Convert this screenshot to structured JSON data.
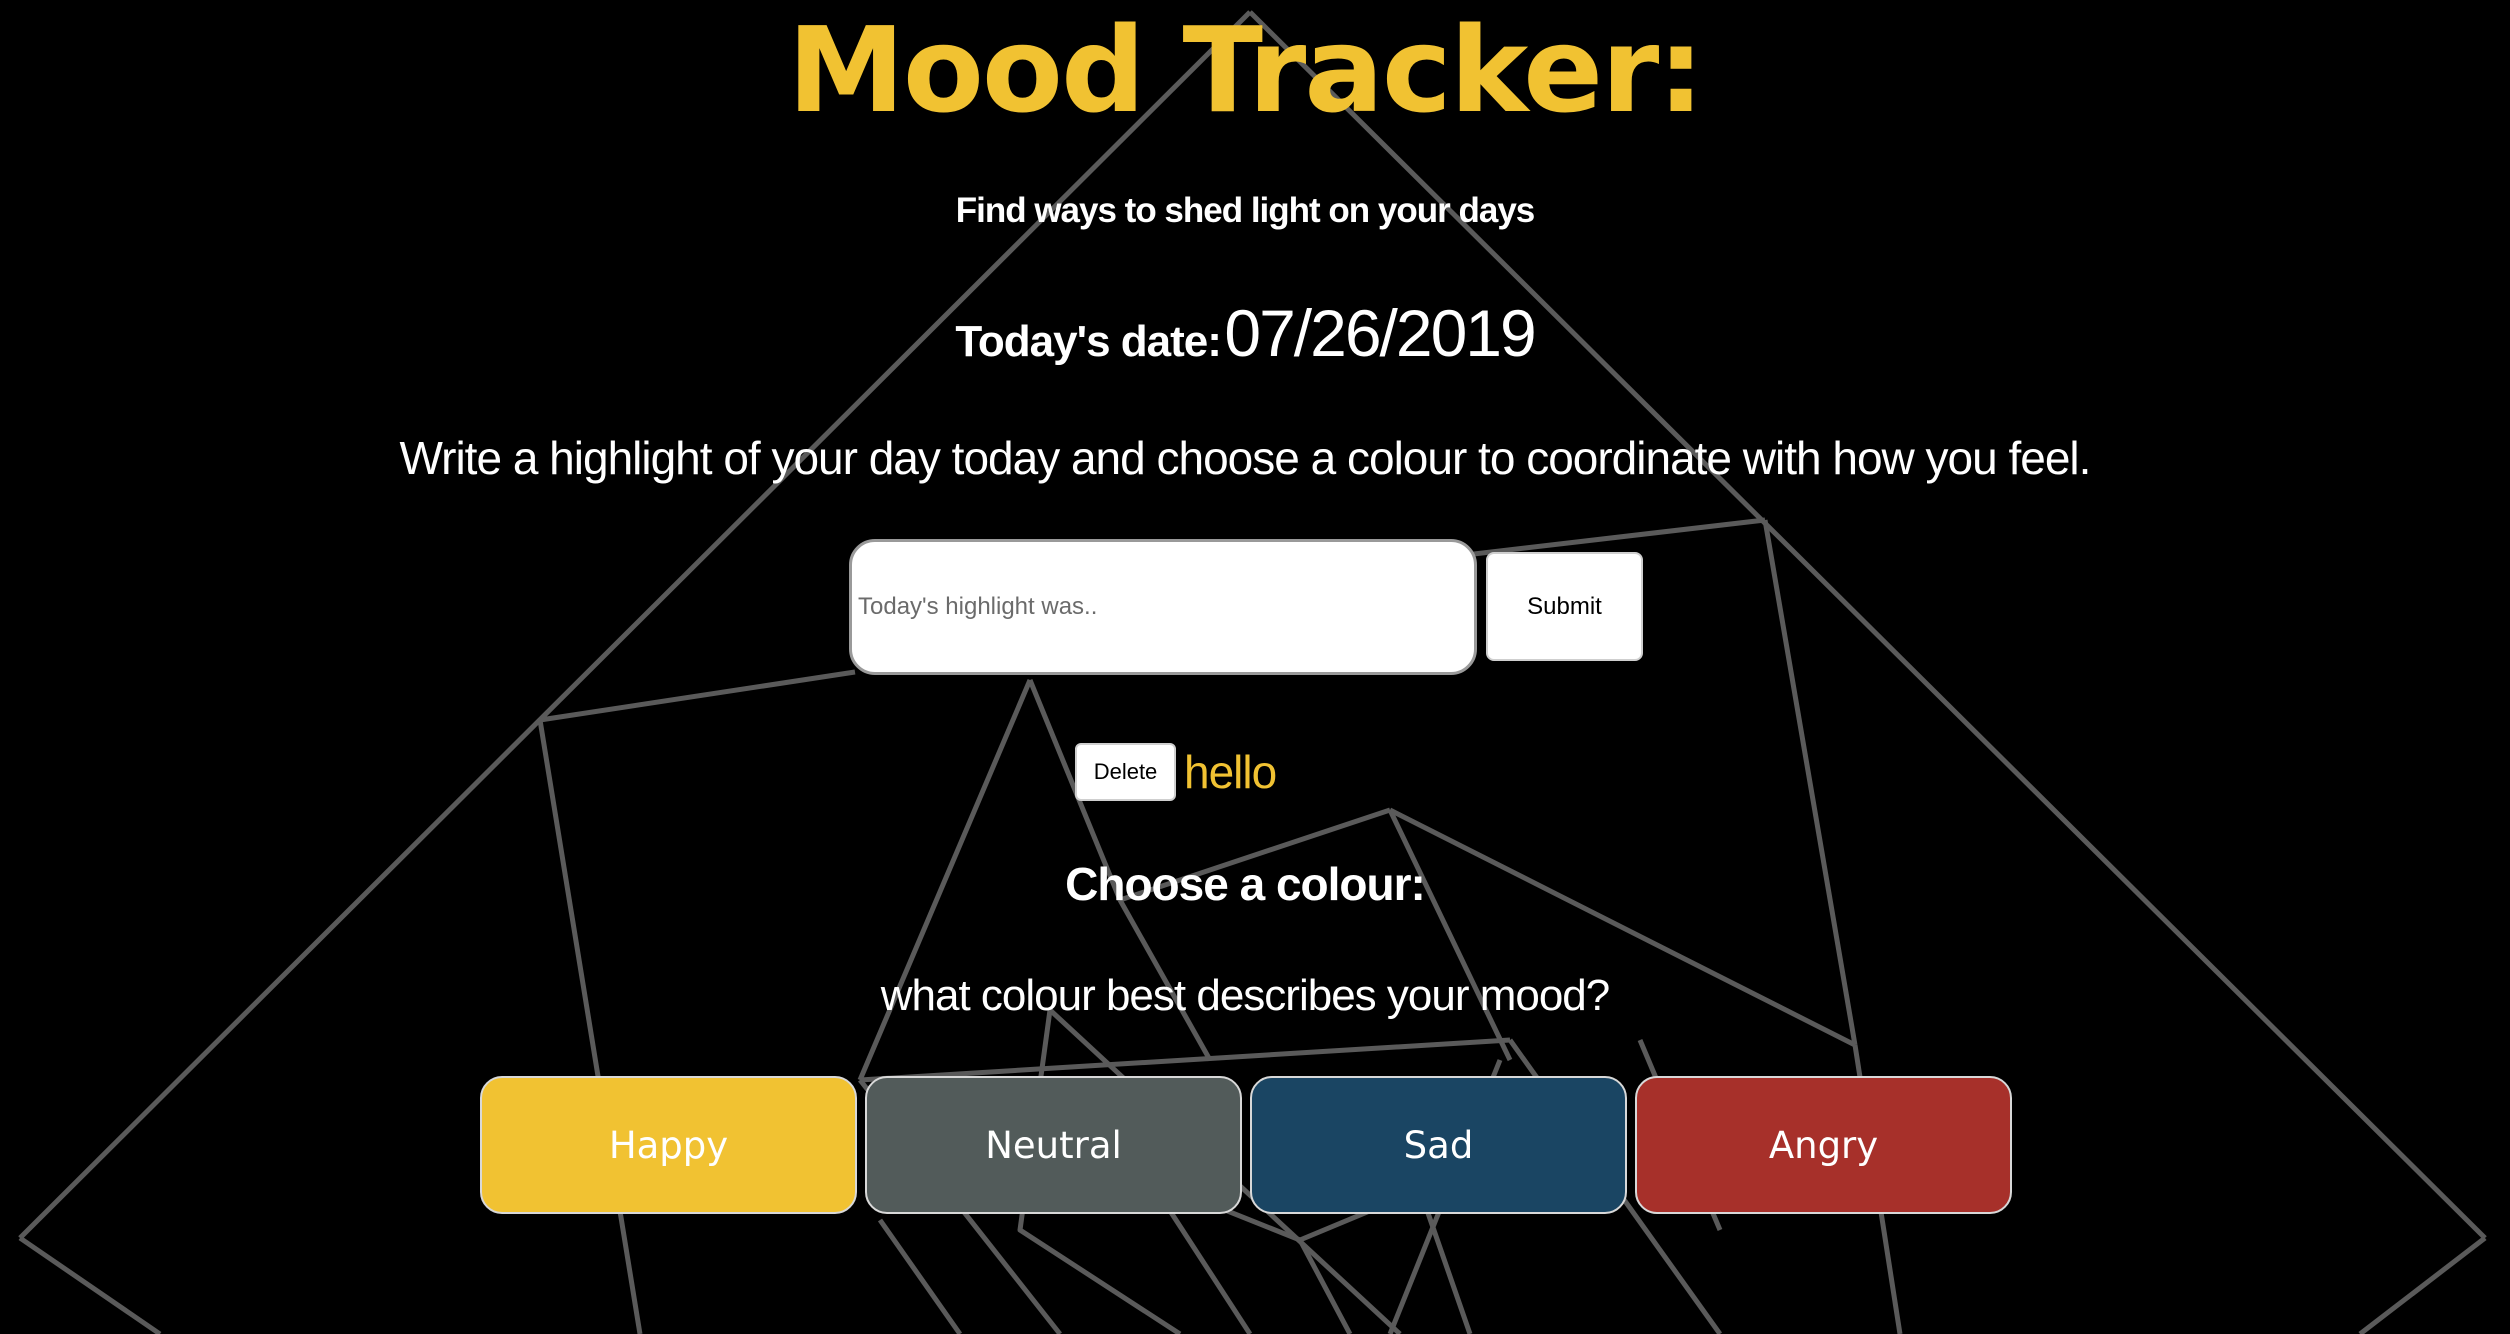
{
  "header": {
    "title": "Mood Tracker:",
    "subtitle": "Find ways to shed light on your days"
  },
  "date": {
    "label": "Today's date:",
    "value": "07/26/2019"
  },
  "instructions": "Write a highlight of your day today and choose a colour to coordinate with how you feel.",
  "highlight_form": {
    "placeholder": "Today's highlight was..",
    "value": "",
    "submit_label": "Submit"
  },
  "entries": [
    {
      "delete_label": "Delete",
      "text": "hello"
    }
  ],
  "colour_section": {
    "heading": "Choose a colour:",
    "question": "what colour best describes your mood?",
    "moods": [
      {
        "label": "Happy",
        "color": "#f1c232"
      },
      {
        "label": "Neutral",
        "color": "#525b5a"
      },
      {
        "label": "Sad",
        "color": "#1a4563"
      },
      {
        "label": "Angry",
        "color": "#a7302a"
      }
    ]
  },
  "theme": {
    "background": "#000000",
    "accent": "#f1c232",
    "text": "#ffffff",
    "line_art": "#5a5a5a"
  }
}
